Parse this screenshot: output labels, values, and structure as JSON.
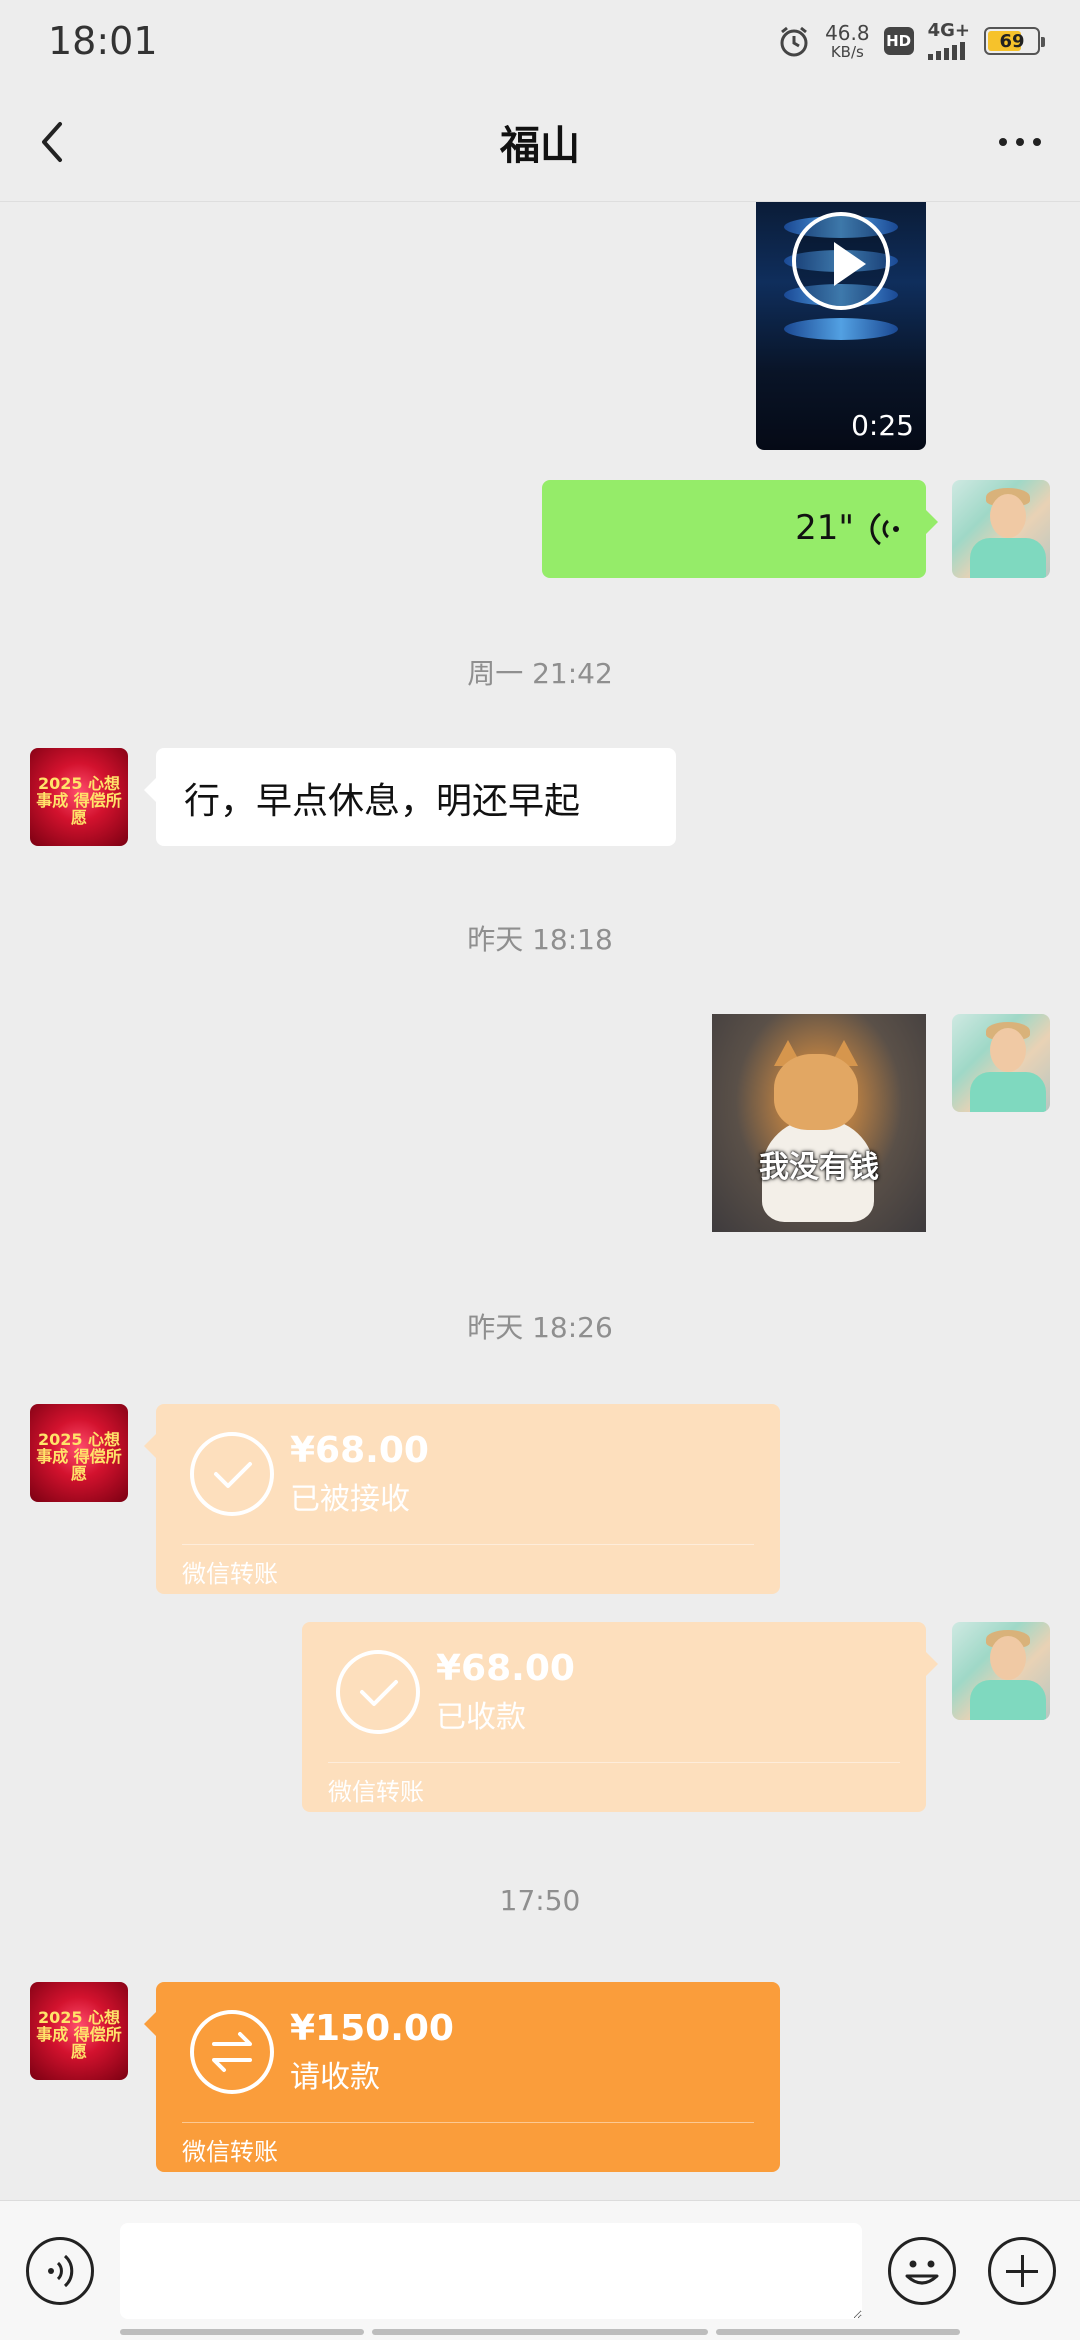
{
  "status_bar": {
    "time": "18:01",
    "net_speed_value": "46.8",
    "net_speed_unit": "KB/s",
    "hd_label": "HD",
    "network_label": "4G+",
    "battery_level": "69",
    "battery_fraction": 0.69
  },
  "nav": {
    "title": "福山",
    "back_icon": "chevron-left-icon",
    "more_icon": "more-dots-icon"
  },
  "messages": {
    "video": {
      "duration": "0:25"
    },
    "voice": {
      "duration": "21\""
    },
    "divider1": "周一 21:42",
    "text_other": "行，早点休息，明还早起",
    "divider2": "昨天 18:18",
    "sticker_caption": "我没有钱",
    "divider3": "昨天 18:26",
    "transfer1": {
      "amount": "¥68.00",
      "status": "已被接收",
      "footer": "微信转账"
    },
    "transfer2": {
      "amount": "¥68.00",
      "status": "已收款",
      "footer": "微信转账"
    },
    "divider4": "17:50",
    "transfer3": {
      "amount": "¥150.00",
      "status": "请收款",
      "footer": "微信转账"
    }
  },
  "avatar_other_text": "2025 心想事成 得偿所愿",
  "colors": {
    "self_bubble": "#95ec69",
    "transfer_received": "#fddfbd",
    "transfer_pending": "#fa9d3b",
    "background": "#ededed"
  }
}
